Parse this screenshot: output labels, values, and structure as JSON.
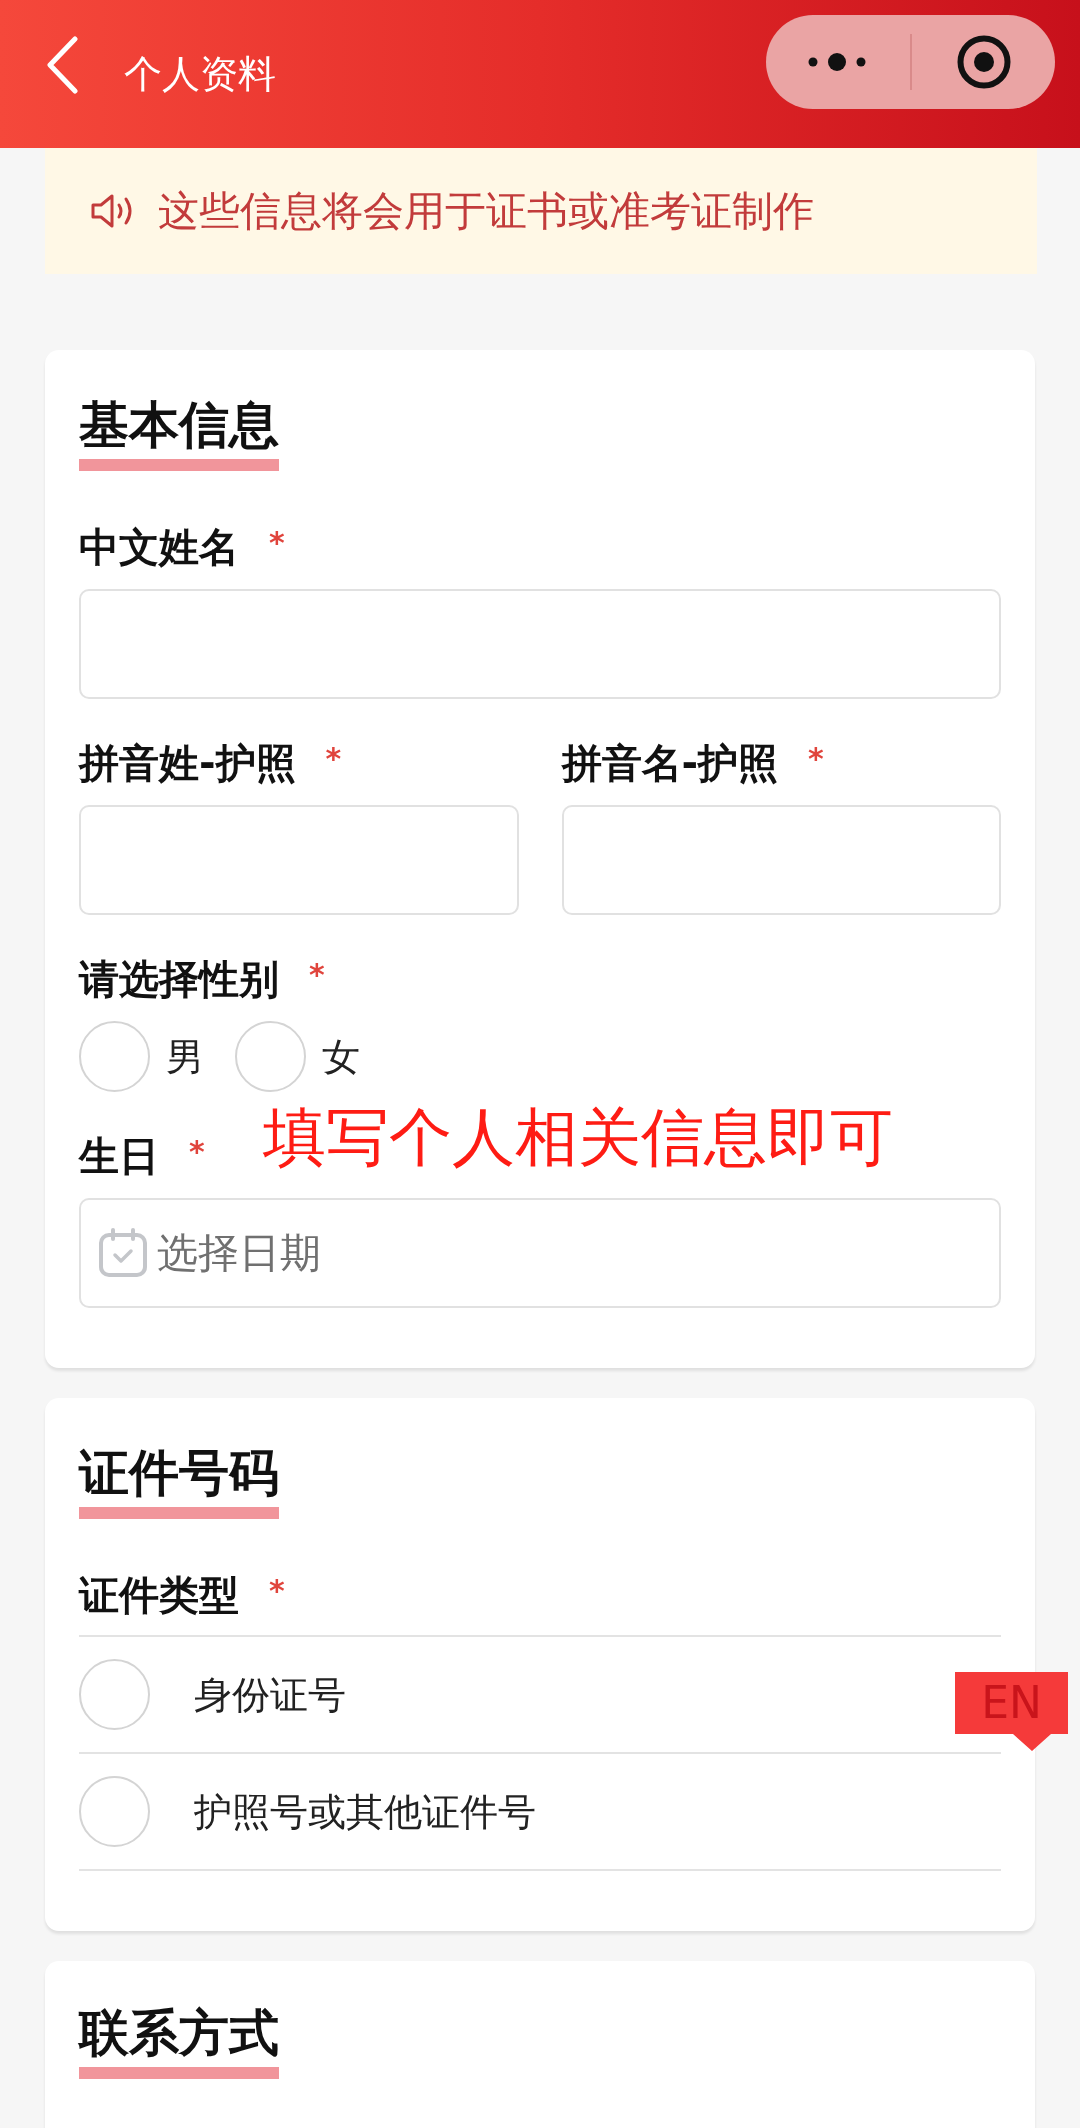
{
  "header": {
    "title": "个人资料"
  },
  "notice": {
    "text": "这些信息将会用于证书或准考证制作"
  },
  "sections": [
    {
      "title": "基本信息",
      "rows": [
        [
          {
            "kind": "text",
            "label": "中文姓名",
            "required_mark": "*"
          }
        ],
        [
          {
            "kind": "text",
            "label": "拼音姓-护照",
            "required_mark": "*"
          },
          {
            "kind": "text",
            "label": "拼音名-护照",
            "required_mark": "*"
          }
        ],
        [
          {
            "kind": "radio_inline",
            "label": "请选择性别",
            "required_mark": "*",
            "options": [
              {
                "label": "男",
                "selected": false
              },
              {
                "label": "女",
                "selected": false
              }
            ]
          }
        ],
        [
          {
            "kind": "date",
            "label": "生日",
            "required_mark": "*",
            "placeholder": "选择日期",
            "annotation": "填写个人相关信息即可"
          }
        ]
      ]
    },
    {
      "title": "证件号码",
      "rows": [
        [
          {
            "kind": "radio_list",
            "label": "证件类型",
            "required_mark": "*",
            "options": [
              {
                "label": "身份证号",
                "selected": false
              },
              {
                "label": "护照号或其他证件号",
                "selected": false
              }
            ]
          }
        ]
      ]
    },
    {
      "title": "联系方式"
    }
  ],
  "language_badge": {
    "label": "EN"
  }
}
